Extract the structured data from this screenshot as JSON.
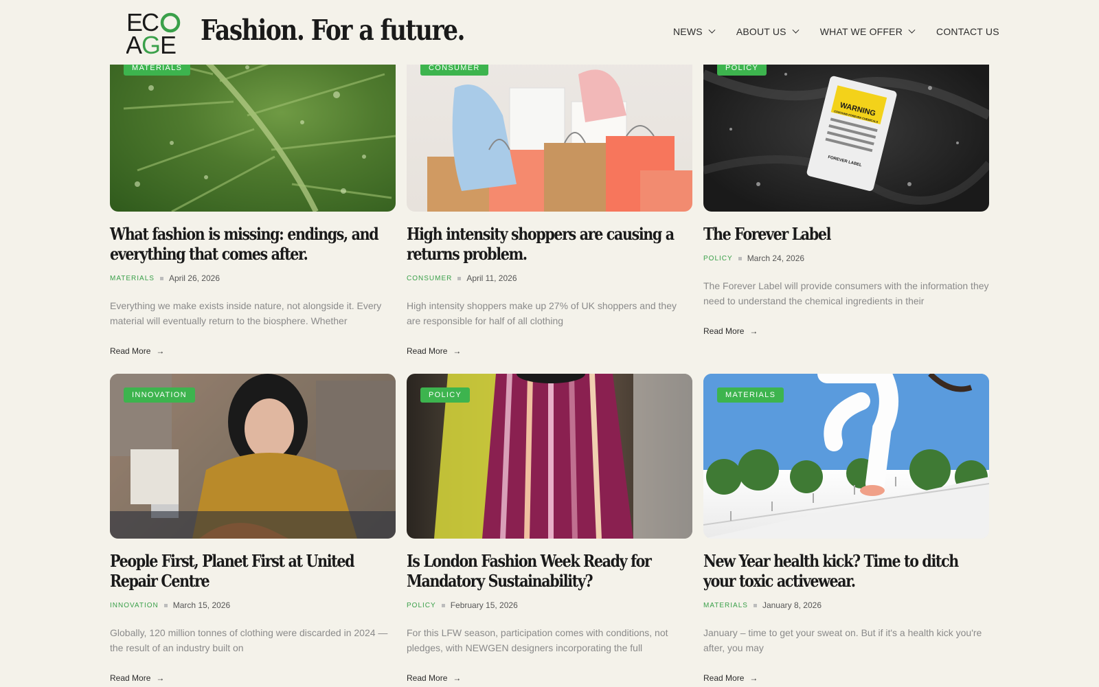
{
  "header": {
    "logo": {
      "top": "ECO",
      "bottom": "AGE"
    },
    "tagline": "Fashion. For a future.",
    "nav": [
      {
        "label": "NEWS",
        "has_dropdown": true
      },
      {
        "label": "ABOUT US",
        "has_dropdown": true
      },
      {
        "label": "WHAT WE OFFER",
        "has_dropdown": true
      },
      {
        "label": "CONTACT US",
        "has_dropdown": false
      }
    ]
  },
  "cards": [
    {
      "badge": "MATERIALS",
      "title": "What fashion is missing: endings, and everything that comes after.",
      "category": "MATERIALS",
      "date": "April 26, 2026",
      "excerpt": "Everything we make exists inside nature, not alongside it. Every material will eventually return to the biosphere. Whether",
      "read_more": "Read More",
      "image_icon": "leaf-image"
    },
    {
      "badge": "CONSUMER",
      "title": "High intensity shoppers are causing a returns problem.",
      "category": "CONSUMER",
      "date": "April 11, 2026",
      "excerpt": "High intensity shoppers make up 27% of UK shoppers and they are responsible for half of all clothing",
      "read_more": "Read More",
      "image_icon": "shopping-bags-image"
    },
    {
      "badge": "POLICY",
      "title": "The Forever Label",
      "category": "POLICY",
      "date": "March 24, 2026",
      "excerpt": "The Forever Label will provide consumers with the information they need to understand the chemical ingredients in their",
      "read_more": "Read More",
      "image_icon": "warning-label-image",
      "tag_text": [
        "WARNING",
        "CONTAINS FOREVER CHEMICALS",
        "FOREVER LABEL"
      ]
    },
    {
      "badge": "INNOVATION",
      "title": "People First, Planet First at United Repair Centre",
      "category": "INNOVATION",
      "date": "March 15, 2026",
      "excerpt": "Globally, 120 million tonnes of clothing were discarded in 2024 — the result of an industry built on",
      "read_more": "Read More",
      "image_icon": "sewing-worker-image"
    },
    {
      "badge": "POLICY",
      "title": "Is London Fashion Week Ready for Mandatory Sustainability?",
      "category": "POLICY",
      "date": "February 15, 2026",
      "excerpt": "For this LFW season, participation comes with conditions, not pledges, with NEWGEN designers incorporating the full",
      "read_more": "Read More",
      "image_icon": "runway-model-image"
    },
    {
      "badge": "MATERIALS",
      "title": "New Year health kick? Time to ditch your toxic activewear.",
      "category": "MATERIALS",
      "date": "January 8, 2026",
      "excerpt": "January – time to get your sweat on. But if it's a health kick you're after, you may",
      "read_more": "Read More",
      "image_icon": "runner-image"
    }
  ],
  "colors": {
    "background": "#f4f2ea",
    "accent_green": "#3db44e",
    "text_dark": "#1a1a1a",
    "excerpt_grey": "#8a8a8a"
  }
}
